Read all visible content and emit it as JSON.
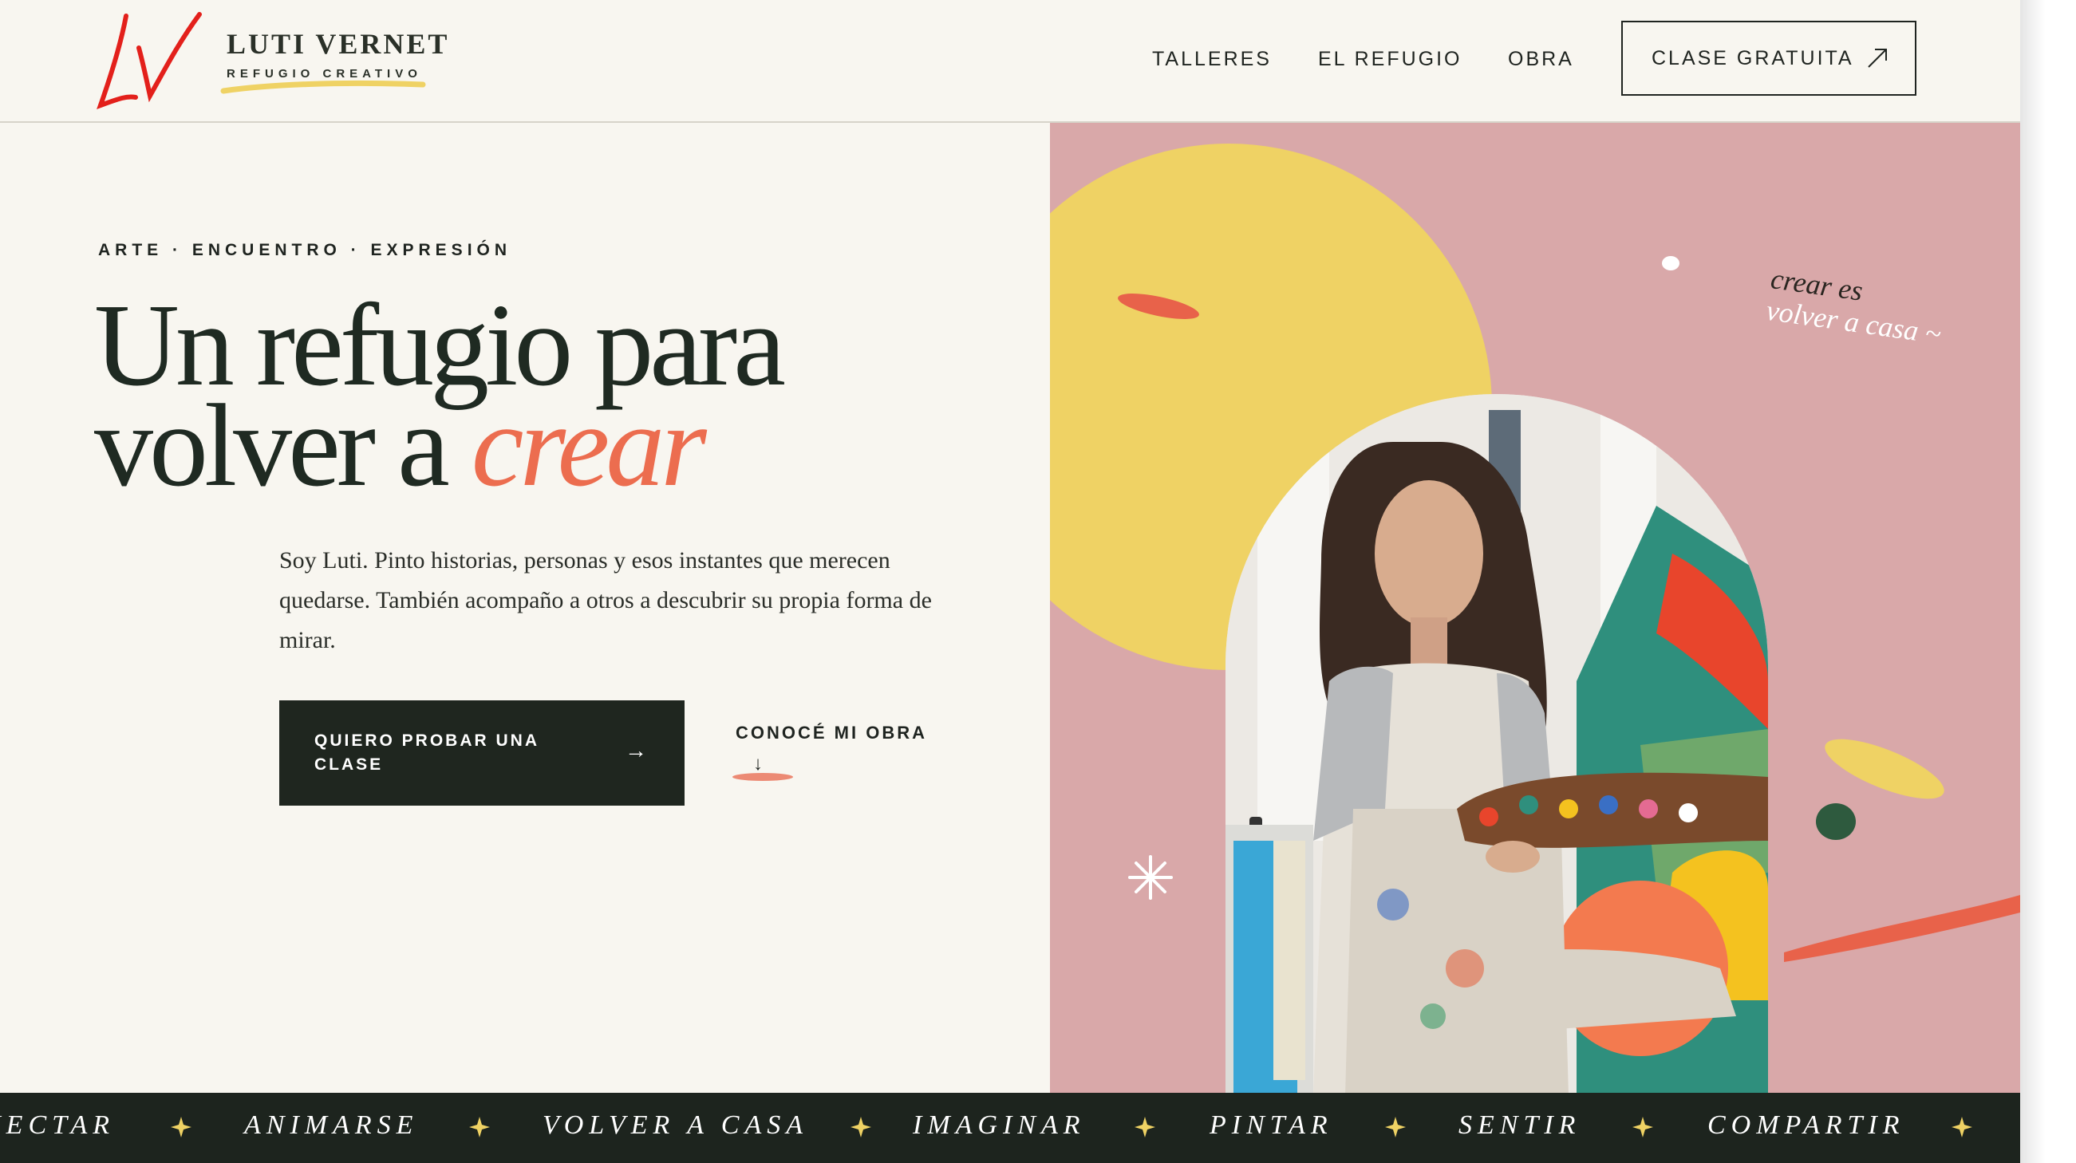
{
  "brand": {
    "monogram": "LV",
    "name": "LUTI VERNET",
    "tagline": "REFUGIO CREATIVO"
  },
  "nav": {
    "items": [
      {
        "label": "TALLERES"
      },
      {
        "label": "EL REFUGIO"
      },
      {
        "label": "OBRA"
      }
    ],
    "cta": {
      "label": "CLASE GRATUITA",
      "icon": "arrow-up-right-icon"
    }
  },
  "hero": {
    "eyebrow": "ARTE · ENCUENTRO · EXPRESIÓN",
    "title_line1": "Un refugio para",
    "title_line2": "volver a",
    "title_accent": "crear",
    "intro": "Soy Luti. Pinto historias, personas y esos instantes que merecen quedarse. También acompaño a otros a descubrir su propia forma de mirar.",
    "primary_button": {
      "label": "QUIERO PROBAR UNA CLASE",
      "arrow": "→"
    },
    "secondary_link": {
      "label": "CONOCÉ MI OBRA",
      "arrow": "↓"
    }
  },
  "art": {
    "note_line1": "crear es",
    "note_line2": "volver a casa ~",
    "photo_alt": "Artist holding a paint palette"
  },
  "marquee": {
    "words": [
      "NECTAR",
      "ANIMARSE",
      "VOLVER A CASA",
      "IMAGINAR",
      "PINTAR",
      "SENTIR",
      "COMPARTIR"
    ]
  },
  "colors": {
    "background": "#f8f6f0",
    "dark": "#1f261f",
    "accent_coral": "#ec6d4f",
    "pink_panel": "#d9a8a9",
    "yellow": "#efd264",
    "logo_red": "#e3201b"
  }
}
